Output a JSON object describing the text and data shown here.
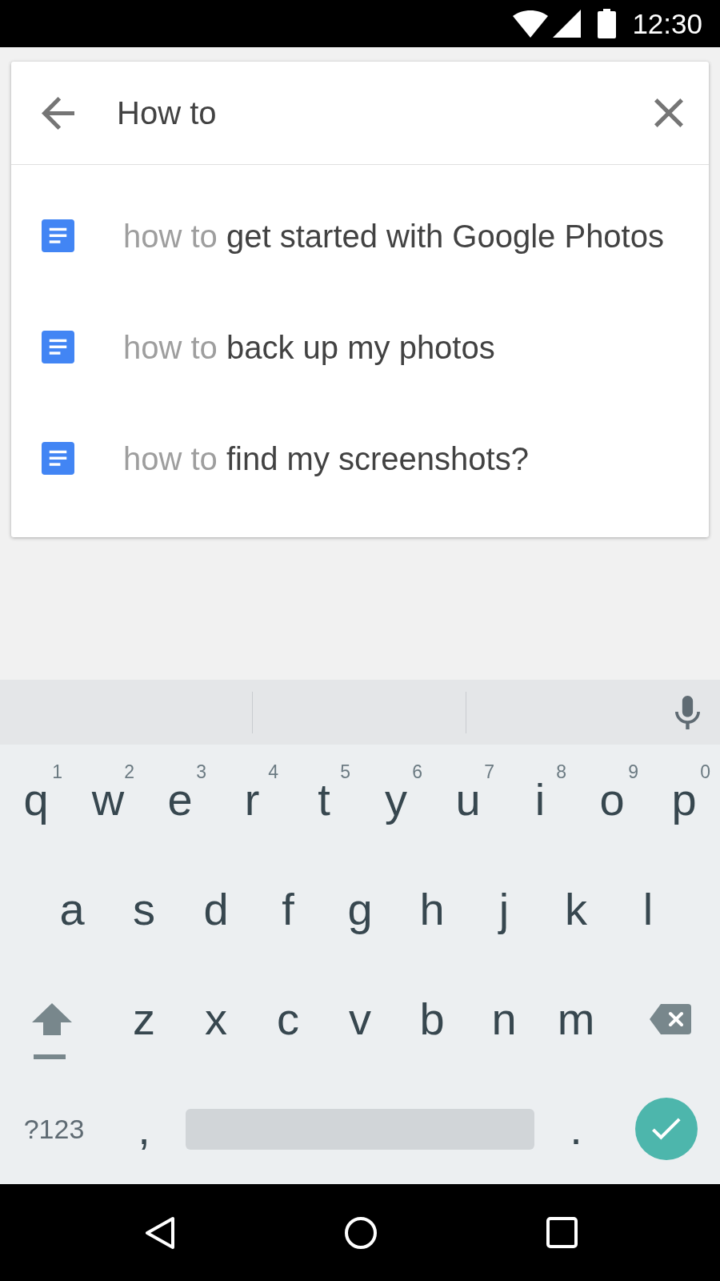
{
  "status_bar": {
    "time": "12:30"
  },
  "search": {
    "value": "How to"
  },
  "suggestions": [
    {
      "prefix": "how to",
      "completion": "get started with Google Photos"
    },
    {
      "prefix": "how to",
      "completion": "back up my photos"
    },
    {
      "prefix": "how to",
      "completion": "find my screenshots?"
    }
  ],
  "keyboard": {
    "letter_rows": [
      [
        {
          "kind": "char",
          "label": "q",
          "hint": "1"
        },
        {
          "kind": "char",
          "label": "w",
          "hint": "2"
        },
        {
          "kind": "char",
          "label": "e",
          "hint": "3"
        },
        {
          "kind": "char",
          "label": "r",
          "hint": "4"
        },
        {
          "kind": "char",
          "label": "t",
          "hint": "5"
        },
        {
          "kind": "char",
          "label": "y",
          "hint": "6"
        },
        {
          "kind": "char",
          "label": "u",
          "hint": "7"
        },
        {
          "kind": "char",
          "label": "i",
          "hint": "8"
        },
        {
          "kind": "char",
          "label": "o",
          "hint": "9"
        },
        {
          "kind": "char",
          "label": "p",
          "hint": "0"
        }
      ],
      [
        {
          "kind": "char",
          "label": "a"
        },
        {
          "kind": "char",
          "label": "s"
        },
        {
          "kind": "char",
          "label": "d"
        },
        {
          "kind": "char",
          "label": "f"
        },
        {
          "kind": "char",
          "label": "g"
        },
        {
          "kind": "char",
          "label": "h"
        },
        {
          "kind": "char",
          "label": "j"
        },
        {
          "kind": "char",
          "label": "k"
        },
        {
          "kind": "char",
          "label": "l"
        }
      ],
      [
        {
          "kind": "shift"
        },
        {
          "kind": "char",
          "label": "z"
        },
        {
          "kind": "char",
          "label": "x"
        },
        {
          "kind": "char",
          "label": "c"
        },
        {
          "kind": "char",
          "label": "v"
        },
        {
          "kind": "char",
          "label": "b"
        },
        {
          "kind": "char",
          "label": "n"
        },
        {
          "kind": "char",
          "label": "m"
        },
        {
          "kind": "backspace"
        }
      ]
    ],
    "bottom_row": [
      {
        "kind": "symbols",
        "label": "?123"
      },
      {
        "kind": "punct",
        "label": ","
      },
      {
        "kind": "space"
      },
      {
        "kind": "punct",
        "label": "."
      },
      {
        "kind": "enter"
      }
    ]
  }
}
